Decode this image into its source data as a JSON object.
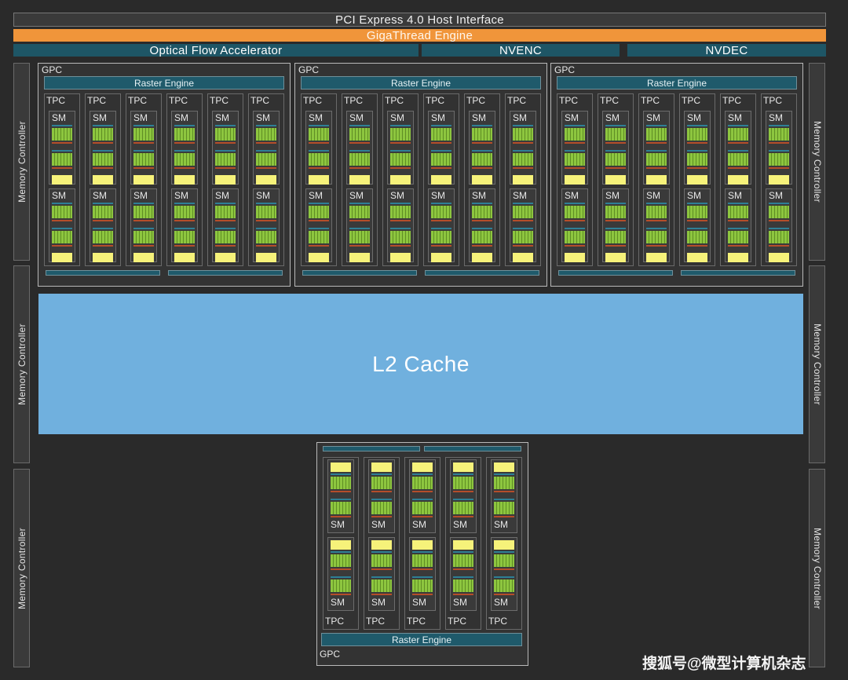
{
  "top": {
    "pcie_label": "PCI Express 4.0 Host Interface",
    "gigathread_label": "GigaThread Engine",
    "optical_flow_label": "Optical Flow Accelerator",
    "nvenc_label": "NVENC",
    "nvdec_label": "NVDEC"
  },
  "memory_controller_label": "Memory Controller",
  "gpc_label": "GPC",
  "raster_engine_label": "Raster Engine",
  "tpc_label": "TPC",
  "sm_label": "SM",
  "l2_cache_label": "L2 Cache",
  "watermark": "搜狐号@微型计算机杂志",
  "counts": {
    "top_gpcs": 3,
    "tpcs_per_top_gpc": 6,
    "bottom_gpc_tpcs": 5,
    "sms_per_tpc": 2
  },
  "colors": {
    "background": "#2a2a2a",
    "gigathread": "#f0953a",
    "teal": "#1e5666",
    "l2_cache": "#70b0de",
    "sm_green": "#8dc63f",
    "sm_yellow": "#f6f27a"
  }
}
